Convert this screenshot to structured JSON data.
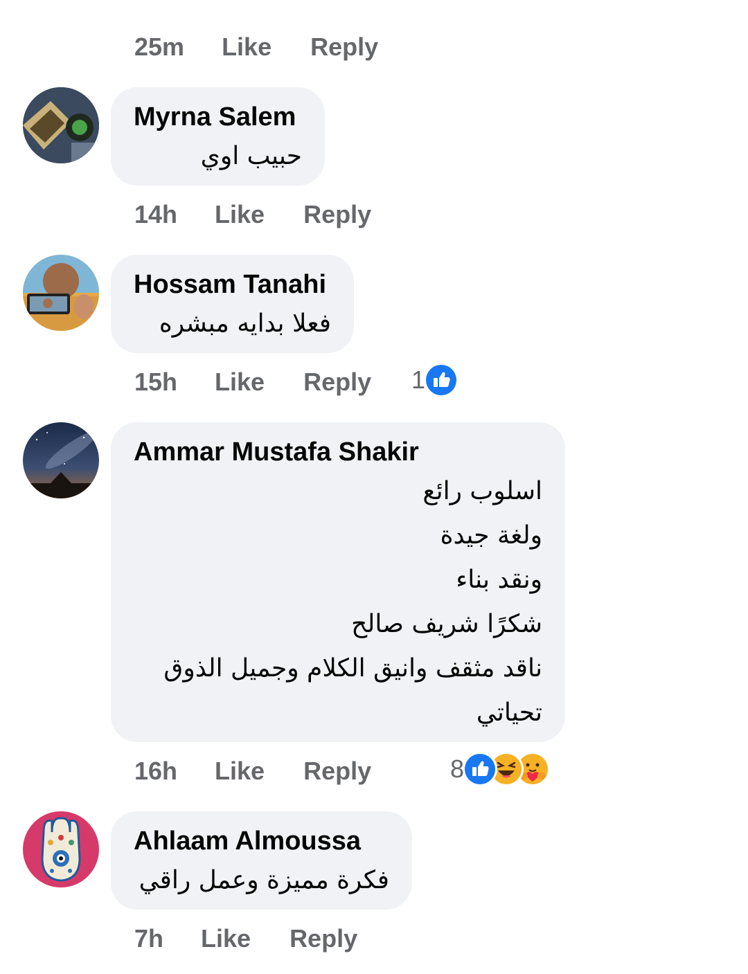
{
  "top_meta": {
    "time": "25m",
    "like": "Like",
    "reply": "Reply"
  },
  "comments": [
    {
      "author": "Myrna Salem",
      "lines": [
        "حبيب اوي"
      ],
      "time": "14h",
      "like": "Like",
      "reply": "Reply",
      "reaction_count": "",
      "reactions": []
    },
    {
      "author": "Hossam Tanahi",
      "lines": [
        "فعلا بدايه مبشره"
      ],
      "time": "15h",
      "like": "Like",
      "reply": "Reply",
      "reaction_count": "1",
      "reactions": [
        "like-reaction-icon"
      ]
    },
    {
      "author": "Ammar Mustafa Shakir",
      "lines": [
        "اسلوب رائع",
        "ولغة جيدة",
        "ونقد بناء",
        "شكرًا شريف صالح",
        "ناقد مثقف وانيق الكلام وجميل الذوق",
        "تحياتي"
      ],
      "time": "16h",
      "like": "Like",
      "reply": "Reply",
      "reaction_count": "8",
      "reactions": [
        "like-reaction-icon",
        "haha-reaction-icon",
        "care-reaction-icon"
      ]
    },
    {
      "author": "Ahlaam Almoussa",
      "lines": [
        "فكرة مميزة وعمل راقي"
      ],
      "time": "7h",
      "like": "Like",
      "reply": "Reply",
      "reaction_count": "",
      "reactions": []
    }
  ],
  "colors": {
    "bubble": "#f0f2f5",
    "meta_text": "#65676b",
    "like_blue": "#1877f2",
    "reaction_yellow": "#f7b125"
  }
}
